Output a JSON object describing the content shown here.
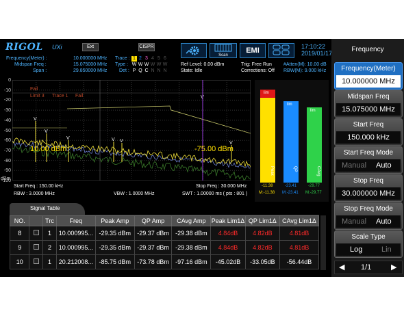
{
  "brand": {
    "logo": "RIGOL",
    "suffix": "UXi",
    "ext_label": "Ext",
    "cispr_label": "CISPR"
  },
  "header": {
    "freq_meter": "Frequency(Meter) :",
    "freq_meter_val": "10.000000 MHz",
    "midspan": "Midspan Freq :",
    "midspan_val": "15.075000 MHz",
    "span": "Span :",
    "span_val": "29.850000 MHz",
    "trace_label": "Trace :",
    "type_label": "Type :",
    "det_label": "Det :",
    "trace_nums": [
      "1",
      "2",
      "3",
      "4",
      "5",
      "6"
    ],
    "type_vals": [
      "W",
      "W",
      "W",
      "W",
      "W",
      "W"
    ],
    "det_vals": [
      "P",
      "Q",
      "C",
      "N",
      "N",
      "N"
    ],
    "ref_level": "Ref Level: 0.00 dBm",
    "state": "State: Idle",
    "trig": "Trig: Free Run",
    "corrections": "Corrections: Off",
    "atten": "#Atten(M): 10.00 dB",
    "rbw_m": "RBW(M): 9.000 kHz",
    "scan_label": "Scan",
    "emi_label": "EMI",
    "time": "17:10:22",
    "date": "2019/01/17"
  },
  "graph": {
    "y_ticks": [
      "0",
      "-10",
      "-20",
      "-30",
      "-40",
      "-50",
      "-60",
      "-70",
      "-80",
      "-90",
      "-100"
    ],
    "y_unit": "dBm",
    "fail_text": "Fail",
    "limit_text": "Limit 3",
    "trace_text": "Trace 1",
    "fail2": "Fail",
    "marker_left": "10.00 dBm",
    "marker_right": "-75.00 dBm",
    "start_freq": "Start Freq : 150.00 kHz",
    "rbw": "RBW : 3.0000 MHz",
    "vbw": "VBW : 1.0000 MHz",
    "stop_freq": "Stop Freq : 30.000 MHz",
    "swt": "SWT : 1.00000 ms ( pts : 801 )"
  },
  "meters": {
    "bars": [
      {
        "name": "Peak",
        "color": "#ffe000",
        "level": -11.38,
        "lim": "lim",
        "val": "-11.38",
        "m": "M:-11.38"
      },
      {
        "name": "QP",
        "color": "#1a8cff",
        "level": -23.41,
        "lim": "lim",
        "val": "-23.41",
        "m": "M:-23.41"
      },
      {
        "name": "CAvg",
        "color": "#2fd24a",
        "level": -29.77,
        "lim": "lim",
        "val": "-29.77",
        "m": "M:-29.77"
      }
    ]
  },
  "signal_table": {
    "title": "Signal Table",
    "columns": [
      "NO.",
      "",
      "Trc",
      "Freq",
      "Peak Amp",
      "QP Amp",
      "CAvg Amp",
      "Peak Lim1Δ",
      "QP Lim1Δ",
      "CAvg Lim1Δ"
    ],
    "rows": [
      {
        "no": "8",
        "trc": "1",
        "freq": "10.000995...",
        "peak": "-29.35 dBm",
        "qp": "-29.37 dBm",
        "cavg": "-29.38 dBm",
        "pl": "4.84dB",
        "ql": "4.82dB",
        "cl": "4.81dB",
        "red": true
      },
      {
        "no": "9",
        "trc": "2",
        "freq": "10.000995...",
        "peak": "-29.35 dBm",
        "qp": "-29.37 dBm",
        "cavg": "-29.38 dBm",
        "pl": "4.84dB",
        "ql": "4.82dB",
        "cl": "4.81dB",
        "red": true
      },
      {
        "no": "10",
        "trc": "1",
        "freq": "20.212008...",
        "peak": "-85.75 dBm",
        "qp": "-73.78 dBm",
        "cavg": "-97.16 dBm",
        "pl": "-45.02dB",
        "ql": "-33.05dB",
        "cl": "-56.44dB",
        "red": false
      }
    ]
  },
  "right_panel": {
    "title": "Frequency",
    "freq_meter": {
      "label": "Frequency(Meter)",
      "value": "10.000000 MHz"
    },
    "midspan": {
      "label": "Midspan Freq",
      "value": "15.075000 MHz"
    },
    "start_freq": {
      "label": "Start Freq",
      "value": "150.000 kHz"
    },
    "start_mode": {
      "label": "Start Freq Mode",
      "opt1": "Manual",
      "opt2": "Auto"
    },
    "stop_freq": {
      "label": "Stop Freq",
      "value": "30.000000 MHz"
    },
    "stop_mode": {
      "label": "Stop Freq Mode",
      "opt1": "Manual",
      "opt2": "Auto"
    },
    "scale": {
      "label": "Scale Type",
      "opt1": "Log",
      "opt2": "Lin"
    },
    "page": "1/1"
  }
}
